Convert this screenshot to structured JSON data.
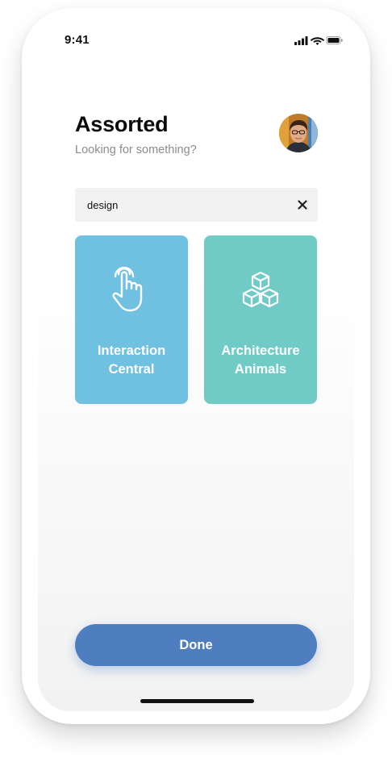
{
  "status_bar": {
    "time": "9:41",
    "icons": [
      "signal-icon",
      "wifi-icon",
      "battery-icon"
    ]
  },
  "header": {
    "title": "Assorted",
    "subtitle": "Looking for something?"
  },
  "search": {
    "value": "design",
    "clear_icon": "close-icon"
  },
  "cards": [
    {
      "line1": "Interaction",
      "line2": "Central",
      "icon": "hand-pointer-icon",
      "color": "#70c0e1"
    },
    {
      "line1": "Architecture",
      "line2": "Animals",
      "icon": "cubes-icon",
      "color": "#70cbc7"
    }
  ],
  "footer": {
    "done_label": "Done",
    "accent": "#4f7ec0"
  }
}
